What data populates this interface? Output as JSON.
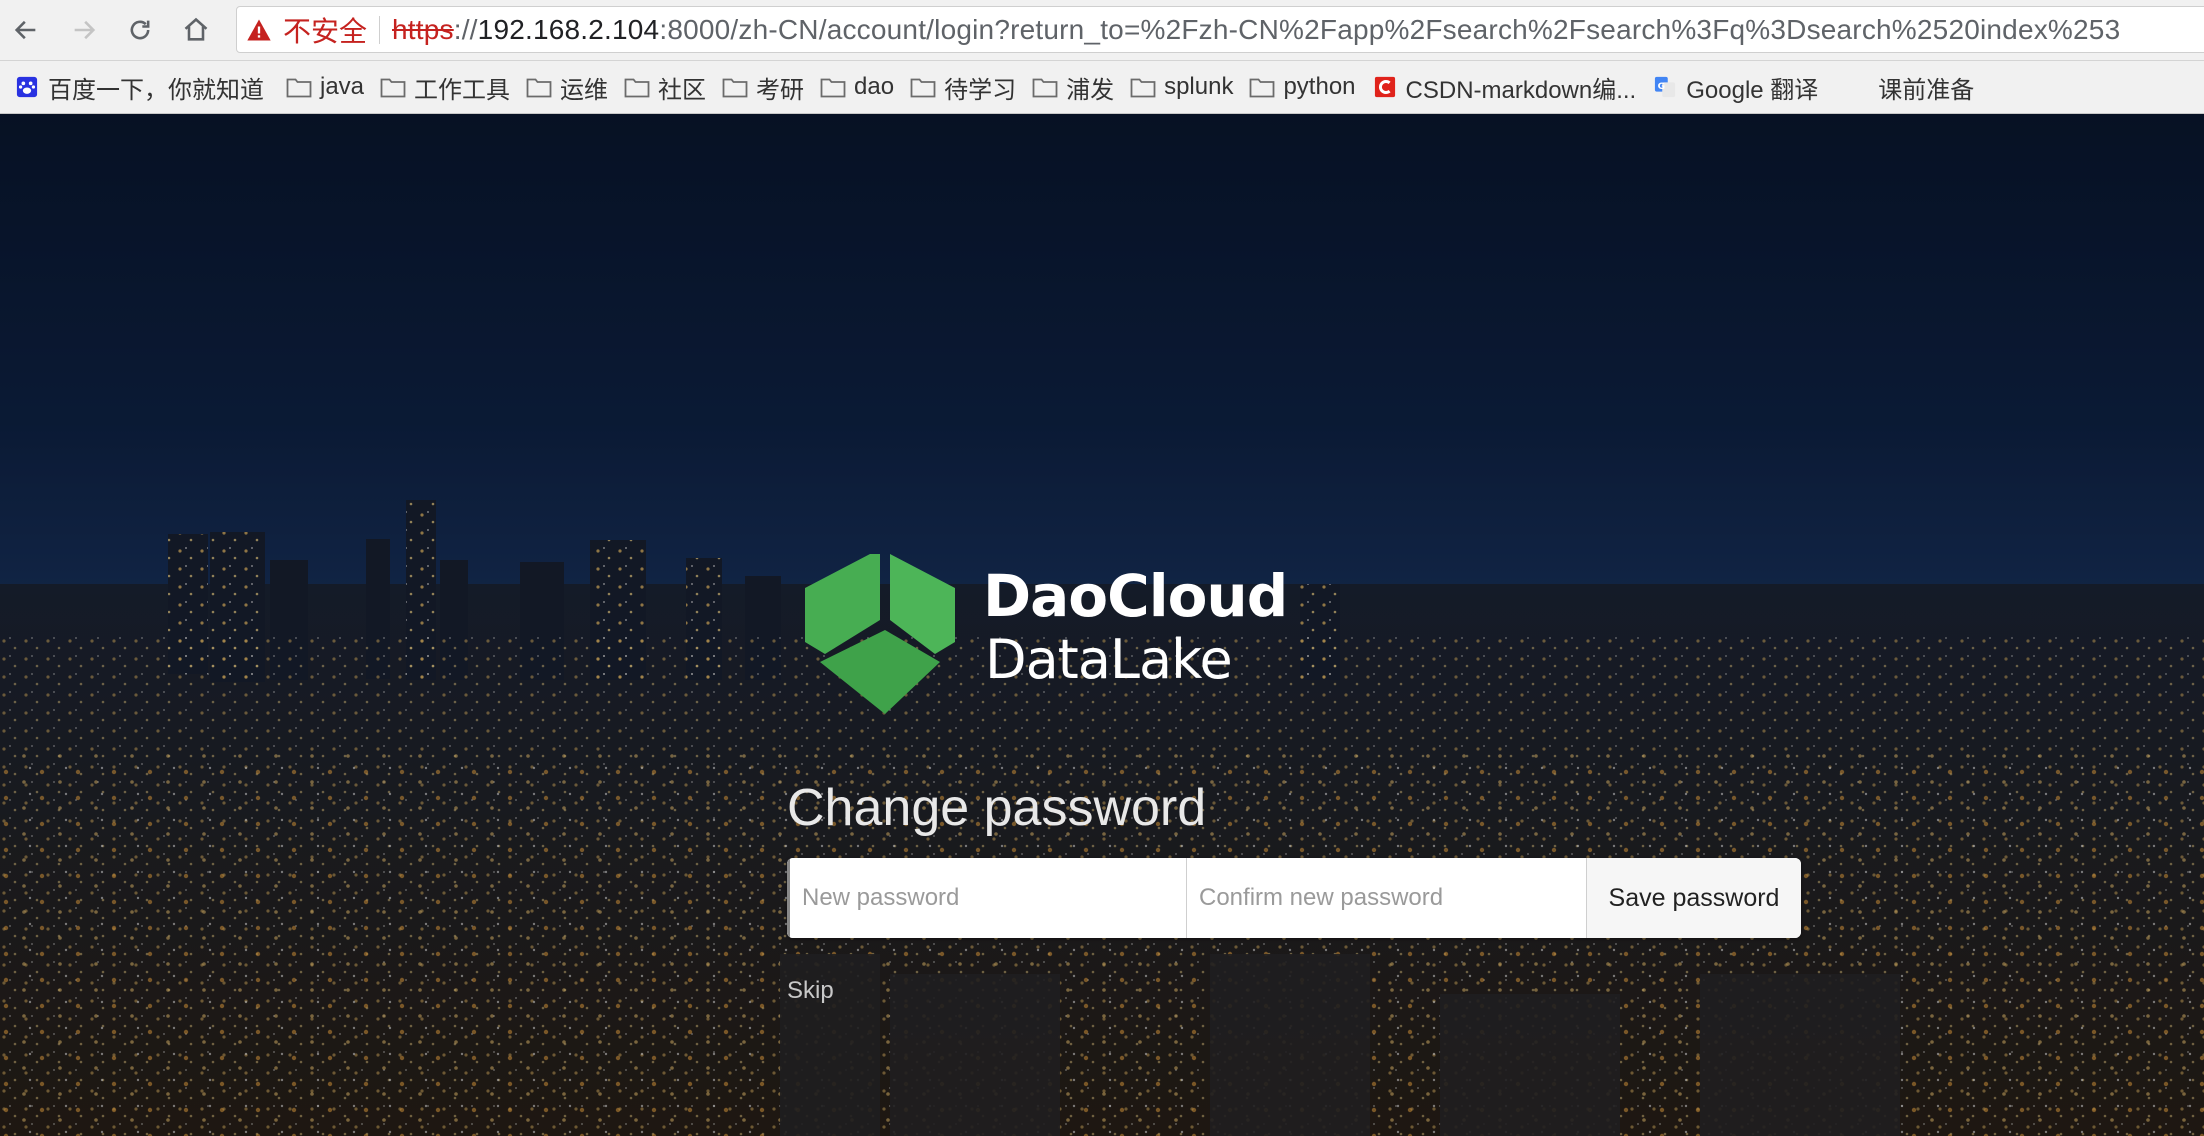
{
  "browser": {
    "security_label": "不安全",
    "url_scheme": "https",
    "url_sep": "://",
    "url_host": "192.168.2.104",
    "url_rest": ":8000/zh-CN/account/login?return_to=%2Fzh-CN%2Fapp%2Fsearch%2Fsearch%3Fq%3Dsearch%2520index%253"
  },
  "bookmarks": [
    {
      "label": "百度一下，你就知道",
      "icon": "baidu-icon"
    },
    {
      "label": "java",
      "icon": "folder-icon"
    },
    {
      "label": "工作工具",
      "icon": "folder-icon"
    },
    {
      "label": "运维",
      "icon": "folder-icon"
    },
    {
      "label": "社区",
      "icon": "folder-icon"
    },
    {
      "label": "考研",
      "icon": "folder-icon"
    },
    {
      "label": "dao",
      "icon": "folder-icon"
    },
    {
      "label": "待学习",
      "icon": "folder-icon"
    },
    {
      "label": "浦发",
      "icon": "folder-icon"
    },
    {
      "label": "splunk",
      "icon": "folder-icon"
    },
    {
      "label": "python",
      "icon": "folder-icon"
    },
    {
      "label": "CSDN-markdown编...",
      "icon": "csdn-icon"
    },
    {
      "label": "Google 翻译",
      "icon": "google-translate-icon"
    },
    {
      "label": "课前准备",
      "icon": ""
    }
  ],
  "logo": {
    "line1": "DaoCloud",
    "line2": "DataLake",
    "color": "#4caf50"
  },
  "form": {
    "title": "Change password",
    "new_password_placeholder": "New password",
    "confirm_password_placeholder": "Confirm new password",
    "save_label": "Save password",
    "skip_label": "Skip"
  }
}
